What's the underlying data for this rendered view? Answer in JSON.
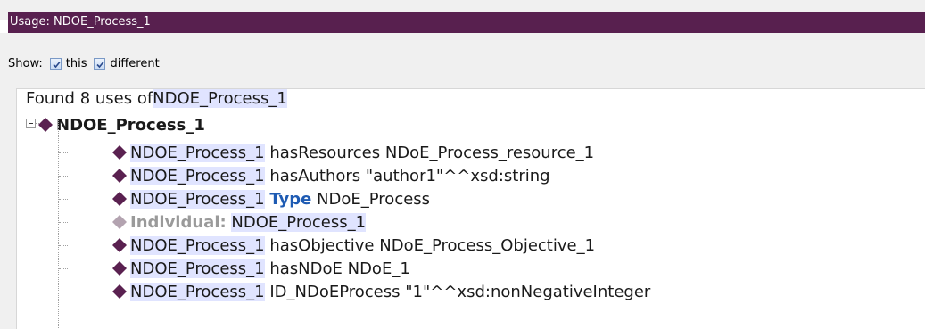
{
  "window": {
    "title": "Usage: NDOE_Process_1"
  },
  "filter": {
    "show_label": "Show:",
    "options": [
      {
        "label": "this",
        "checked": true
      },
      {
        "label": "different",
        "checked": true
      }
    ]
  },
  "tree": {
    "found_prefix": "Found 8 uses of ",
    "found_entity": "NDOE_Process_1",
    "root_label": "NDOE_Process_1",
    "rows": [
      {
        "subject": "NDOE_Process_1",
        "predicate": "hasResources",
        "object": "NDoE_Process_resource_1"
      },
      {
        "subject": "NDOE_Process_1",
        "predicate": "hasAuthors",
        "object": "\"author1\"^^xsd:string"
      },
      {
        "subject": "NDOE_Process_1",
        "predicate": "Type",
        "object": "NDoE_Process"
      },
      {
        "subject": "Individual:",
        "predicate": "",
        "object": "NDOE_Process_1"
      },
      {
        "subject": "NDOE_Process_1",
        "predicate": "hasObjective",
        "object": "NDoE_Process_Objective_1"
      },
      {
        "subject": "NDOE_Process_1",
        "predicate": "hasNDoE",
        "object": "NDoE_1"
      },
      {
        "subject": "NDOE_Process_1",
        "predicate": "ID_NDoEProcess",
        "object": "\"1\"^^xsd:nonNegativeInteger"
      }
    ]
  },
  "colors": {
    "title_bar": "#58204f",
    "highlight": "#e0e4ff",
    "individual_diamond": "#5a2150",
    "keyword": "#1e5bb3"
  },
  "icons": {
    "individual": "diamond-icon",
    "expander": "collapse-icon"
  }
}
